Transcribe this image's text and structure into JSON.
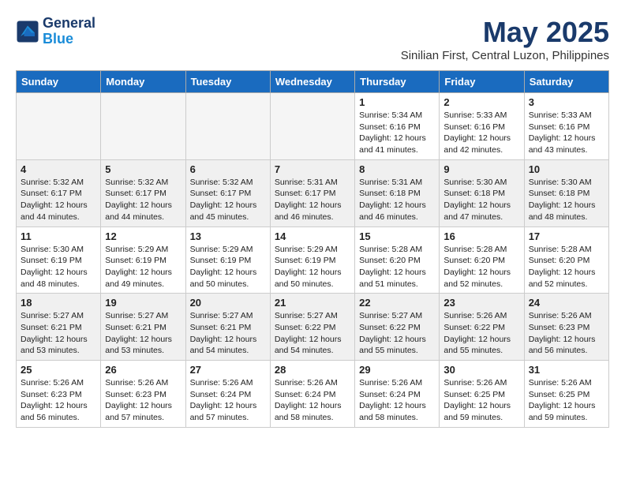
{
  "header": {
    "logo_line1": "General",
    "logo_line2": "Blue",
    "month": "May 2025",
    "location": "Sinilian First, Central Luzon, Philippines"
  },
  "days_of_week": [
    "Sunday",
    "Monday",
    "Tuesday",
    "Wednesday",
    "Thursday",
    "Friday",
    "Saturday"
  ],
  "weeks": [
    [
      {
        "day": "",
        "empty": true
      },
      {
        "day": "",
        "empty": true
      },
      {
        "day": "",
        "empty": true
      },
      {
        "day": "",
        "empty": true
      },
      {
        "day": "1",
        "sunrise": "5:34 AM",
        "sunset": "6:16 PM",
        "daylight": "12 hours and 41 minutes."
      },
      {
        "day": "2",
        "sunrise": "5:33 AM",
        "sunset": "6:16 PM",
        "daylight": "12 hours and 42 minutes."
      },
      {
        "day": "3",
        "sunrise": "5:33 AM",
        "sunset": "6:16 PM",
        "daylight": "12 hours and 43 minutes."
      }
    ],
    [
      {
        "day": "4",
        "sunrise": "5:32 AM",
        "sunset": "6:17 PM",
        "daylight": "12 hours and 44 minutes."
      },
      {
        "day": "5",
        "sunrise": "5:32 AM",
        "sunset": "6:17 PM",
        "daylight": "12 hours and 44 minutes."
      },
      {
        "day": "6",
        "sunrise": "5:32 AM",
        "sunset": "6:17 PM",
        "daylight": "12 hours and 45 minutes."
      },
      {
        "day": "7",
        "sunrise": "5:31 AM",
        "sunset": "6:17 PM",
        "daylight": "12 hours and 46 minutes."
      },
      {
        "day": "8",
        "sunrise": "5:31 AM",
        "sunset": "6:18 PM",
        "daylight": "12 hours and 46 minutes."
      },
      {
        "day": "9",
        "sunrise": "5:30 AM",
        "sunset": "6:18 PM",
        "daylight": "12 hours and 47 minutes."
      },
      {
        "day": "10",
        "sunrise": "5:30 AM",
        "sunset": "6:18 PM",
        "daylight": "12 hours and 48 minutes."
      }
    ],
    [
      {
        "day": "11",
        "sunrise": "5:30 AM",
        "sunset": "6:19 PM",
        "daylight": "12 hours and 48 minutes."
      },
      {
        "day": "12",
        "sunrise": "5:29 AM",
        "sunset": "6:19 PM",
        "daylight": "12 hours and 49 minutes."
      },
      {
        "day": "13",
        "sunrise": "5:29 AM",
        "sunset": "6:19 PM",
        "daylight": "12 hours and 50 minutes."
      },
      {
        "day": "14",
        "sunrise": "5:29 AM",
        "sunset": "6:19 PM",
        "daylight": "12 hours and 50 minutes."
      },
      {
        "day": "15",
        "sunrise": "5:28 AM",
        "sunset": "6:20 PM",
        "daylight": "12 hours and 51 minutes."
      },
      {
        "day": "16",
        "sunrise": "5:28 AM",
        "sunset": "6:20 PM",
        "daylight": "12 hours and 52 minutes."
      },
      {
        "day": "17",
        "sunrise": "5:28 AM",
        "sunset": "6:20 PM",
        "daylight": "12 hours and 52 minutes."
      }
    ],
    [
      {
        "day": "18",
        "sunrise": "5:27 AM",
        "sunset": "6:21 PM",
        "daylight": "12 hours and 53 minutes."
      },
      {
        "day": "19",
        "sunrise": "5:27 AM",
        "sunset": "6:21 PM",
        "daylight": "12 hours and 53 minutes."
      },
      {
        "day": "20",
        "sunrise": "5:27 AM",
        "sunset": "6:21 PM",
        "daylight": "12 hours and 54 minutes."
      },
      {
        "day": "21",
        "sunrise": "5:27 AM",
        "sunset": "6:22 PM",
        "daylight": "12 hours and 54 minutes."
      },
      {
        "day": "22",
        "sunrise": "5:27 AM",
        "sunset": "6:22 PM",
        "daylight": "12 hours and 55 minutes."
      },
      {
        "day": "23",
        "sunrise": "5:26 AM",
        "sunset": "6:22 PM",
        "daylight": "12 hours and 55 minutes."
      },
      {
        "day": "24",
        "sunrise": "5:26 AM",
        "sunset": "6:23 PM",
        "daylight": "12 hours and 56 minutes."
      }
    ],
    [
      {
        "day": "25",
        "sunrise": "5:26 AM",
        "sunset": "6:23 PM",
        "daylight": "12 hours and 56 minutes."
      },
      {
        "day": "26",
        "sunrise": "5:26 AM",
        "sunset": "6:23 PM",
        "daylight": "12 hours and 57 minutes."
      },
      {
        "day": "27",
        "sunrise": "5:26 AM",
        "sunset": "6:24 PM",
        "daylight": "12 hours and 57 minutes."
      },
      {
        "day": "28",
        "sunrise": "5:26 AM",
        "sunset": "6:24 PM",
        "daylight": "12 hours and 58 minutes."
      },
      {
        "day": "29",
        "sunrise": "5:26 AM",
        "sunset": "6:24 PM",
        "daylight": "12 hours and 58 minutes."
      },
      {
        "day": "30",
        "sunrise": "5:26 AM",
        "sunset": "6:25 PM",
        "daylight": "12 hours and 59 minutes."
      },
      {
        "day": "31",
        "sunrise": "5:26 AM",
        "sunset": "6:25 PM",
        "daylight": "12 hours and 59 minutes."
      }
    ]
  ]
}
